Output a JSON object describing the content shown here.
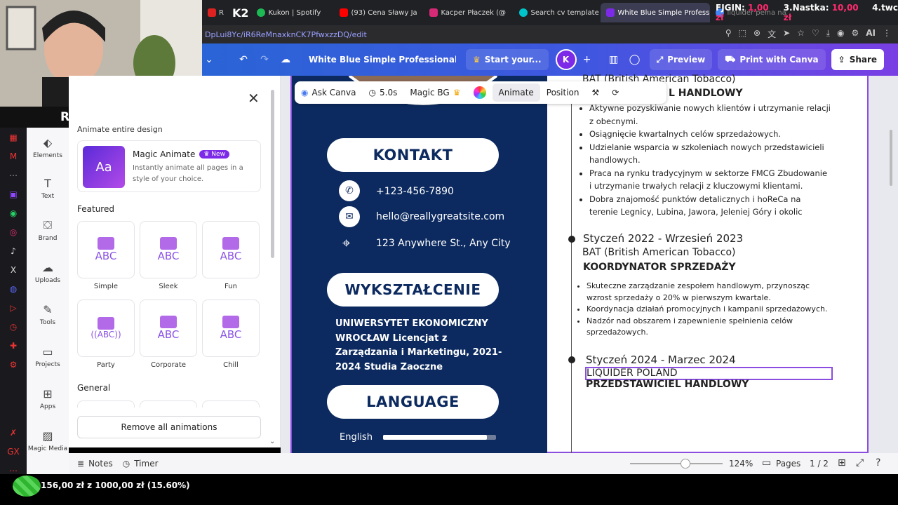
{
  "browser": {
    "tabs": [
      {
        "label": "R",
        "color": "#d22"
      },
      {
        "label": "Kukon | Spotify",
        "color": "#1db954"
      },
      {
        "label": "(93) Cena Sławy Ja",
        "color": "#f00"
      },
      {
        "label": "Kacper Płaczek (@",
        "color": "#d62976"
      },
      {
        "label": "Search cv template",
        "color": "#00c4cc"
      },
      {
        "label": "White Blue Simple Profess",
        "color": "#7d2ae8",
        "active": true
      },
      {
        "label": "liquider pełna nazw",
        "color": "#4285f4"
      }
    ],
    "url": "DpLui8Yc/iR6ReMnaxknCK7PfwxzzDQ/edit",
    "tab_logo": "K2"
  },
  "stream": {
    "name": "RUDYKAPI",
    "top_donors": [
      {
        "label": "FJGIN:",
        "amount": "1,00 zł"
      },
      {
        "label": "3.Nastka:",
        "amount": "10,00 zł"
      },
      {
        "label": "4.twc",
        "amount": ""
      }
    ],
    "goal_text": "156,00 zł z 1000,00 zł (15.60%)",
    "goal_progress": 0.156
  },
  "header": {
    "doc_title": "White Blue Simple Professional C...",
    "start_label": "Start your...",
    "avatar": "K",
    "preview": "Preview",
    "print": "Print with Canva",
    "share": "Share"
  },
  "leftnav": [
    {
      "label": "Elements",
      "icon": "elements-icon"
    },
    {
      "label": "Text",
      "icon": "text-icon"
    },
    {
      "label": "Brand",
      "icon": "brand-icon"
    },
    {
      "label": "Uploads",
      "icon": "uploads-icon"
    },
    {
      "label": "Tools",
      "icon": "tools-icon"
    },
    {
      "label": "Projects",
      "icon": "projects-icon"
    },
    {
      "label": "Apps",
      "icon": "apps-icon"
    },
    {
      "label": "Magic Media",
      "icon": "magic-media-icon"
    }
  ],
  "panel": {
    "section_title": "Animate entire design",
    "magic_title": "Magic Animate",
    "magic_badge": "New",
    "magic_desc": "Instantly animate all pages in a style of your choice.",
    "featured_title": "Featured",
    "featured": [
      {
        "label": "Simple",
        "glyph": "ABC"
      },
      {
        "label": "Sleek",
        "glyph": "ABC"
      },
      {
        "label": "Fun",
        "glyph": "ABC"
      },
      {
        "label": "Party",
        "glyph": "((ABC))"
      },
      {
        "label": "Corporate",
        "glyph": "ABC"
      },
      {
        "label": "Chill",
        "glyph": "ABC"
      }
    ],
    "general_title": "General",
    "remove_label": "Remove all animations"
  },
  "toolbar": {
    "ask": "Ask Canva",
    "duration": "5.0s",
    "magic_bg": "Magic BG",
    "animate": "Animate",
    "position": "Position"
  },
  "cv_left": {
    "contact_title": "KONTAKT",
    "phone": "+123-456-7890",
    "email": "hello@reallygreatsite.com",
    "address": "123 Anywhere St., Any City",
    "education_title": "WYKSZTAŁCENIE",
    "education_text": "UNIWERSYTET EKONOMICZNY WROCŁAW Licencjat z Zarządzania i Marketingu, 2021-2024 Studia Zaoczne",
    "language_title": "LANGUAGE",
    "language": "English",
    "language_level": 0.92
  },
  "cv_right": {
    "job0_company": "BAT (British American Tobacco)",
    "job0_title": "L HANDLOWY",
    "job0_bullets": [
      "Aktywne pozyskiwanie nowych klientów i utrzymanie relacji z obecnymi.",
      "Osiągnięcie kwartalnych celów sprzedażowych.",
      "Udzielanie wsparcia w szkoleniach nowych przedstawicieli handlowych.",
      "Praca na rynku tradycyjnym w sektorze FMCG Zbudowanie i utrzymanie trwałych relacji z kluczowymi klientami.",
      "Dobra znajomość punktów detalicznych i hoReCa na terenie Legnicy, Lubina, Jawora, Jeleniej Góry i okolic"
    ],
    "job1_dates": "Styczeń 2022 - Wrzesień 2023",
    "job1_company": "BAT (British American Tobacco)",
    "job1_title": "KOORDYNATOR SPRZEDAŻY",
    "job1_bullets": [
      "Skuteczne zarządzanie zespołem handlowym, przynosząc wzrost sprzedaży o 20% w pierwszym kwartale.",
      "Koordynacja działań promocyjnych i kampanii sprzedażowych.",
      "Nadzór nad obszarem i zapewnienie spełnienia celów sprzedażowych."
    ],
    "job2_dates": "Styczeń 2024 - Marzec 2024",
    "job2_company": "LIQUIDER POLAND",
    "job2_title": "PRZEDSTAWICIEL HANDLOWY"
  },
  "footer": {
    "notes": "Notes",
    "timer": "Timer",
    "zoom": "124%",
    "zoom_level": 0.6,
    "pages": "Pages",
    "page_count": "1 / 2"
  },
  "colors": {
    "accent": "#7d2ae8",
    "cv_navy": "#0c2a5f"
  }
}
